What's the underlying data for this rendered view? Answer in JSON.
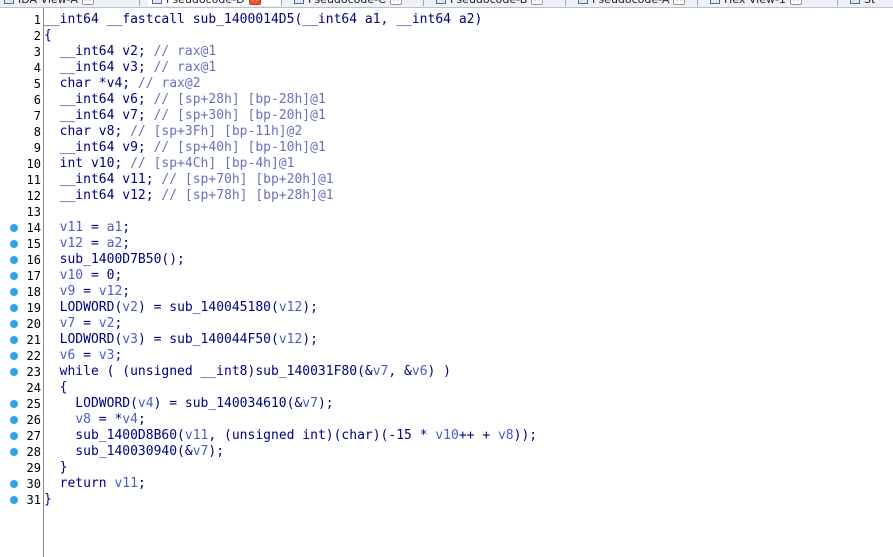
{
  "tabs": [
    {
      "label": "IDA View-A",
      "close": "×",
      "active": false
    },
    {
      "label": "Pseudocode-D",
      "close": "×",
      "active": true
    },
    {
      "label": "Pseudocode-C",
      "close": "×",
      "active": false
    },
    {
      "label": "Pseudocode-B",
      "close": "×",
      "active": false
    },
    {
      "label": "Pseudocode-A",
      "close": "×",
      "active": false
    },
    {
      "label": "Hex View-1",
      "close": "×",
      "active": false
    },
    {
      "label": "St",
      "close": "",
      "active": false
    }
  ],
  "colors": {
    "code_text": "#000080",
    "comment": "#6a70c0",
    "variable": "#4c5cc8",
    "breakpoint_dot": "#2fa3e6"
  },
  "lines": [
    {
      "n": "1",
      "dot": false,
      "segs": [
        {
          "t": "__int64 __fastcall sub_1400014D5(__int64 a1, __int64 a2)",
          "c": ""
        }
      ]
    },
    {
      "n": "2",
      "dot": false,
      "segs": [
        {
          "t": "{",
          "c": ""
        }
      ]
    },
    {
      "n": "3",
      "dot": false,
      "segs": [
        {
          "t": "  __int64 v2; ",
          "c": ""
        },
        {
          "t": "// rax@1",
          "c": "comment"
        }
      ]
    },
    {
      "n": "4",
      "dot": false,
      "segs": [
        {
          "t": "  __int64 v3; ",
          "c": ""
        },
        {
          "t": "// rax@1",
          "c": "comment"
        }
      ]
    },
    {
      "n": "5",
      "dot": false,
      "segs": [
        {
          "t": "  char *v4; ",
          "c": ""
        },
        {
          "t": "// rax@2",
          "c": "comment"
        }
      ]
    },
    {
      "n": "6",
      "dot": false,
      "segs": [
        {
          "t": "  __int64 v6; ",
          "c": ""
        },
        {
          "t": "// [sp+28h] [bp-28h]@1",
          "c": "comment"
        }
      ]
    },
    {
      "n": "7",
      "dot": false,
      "segs": [
        {
          "t": "  __int64 v7; ",
          "c": ""
        },
        {
          "t": "// [sp+30h] [bp-20h]@1",
          "c": "comment"
        }
      ]
    },
    {
      "n": "8",
      "dot": false,
      "segs": [
        {
          "t": "  char v8; ",
          "c": ""
        },
        {
          "t": "// [sp+3Fh] [bp-11h]@2",
          "c": "comment"
        }
      ]
    },
    {
      "n": "9",
      "dot": false,
      "segs": [
        {
          "t": "  __int64 v9; ",
          "c": ""
        },
        {
          "t": "// [sp+40h] [bp-10h]@1",
          "c": "comment"
        }
      ]
    },
    {
      "n": "10",
      "dot": false,
      "segs": [
        {
          "t": "  int v10; ",
          "c": ""
        },
        {
          "t": "// [sp+4Ch] [bp-4h]@1",
          "c": "comment"
        }
      ]
    },
    {
      "n": "11",
      "dot": false,
      "segs": [
        {
          "t": "  __int64 v11; ",
          "c": ""
        },
        {
          "t": "// [sp+70h] [bp+20h]@1",
          "c": "comment"
        }
      ]
    },
    {
      "n": "12",
      "dot": false,
      "segs": [
        {
          "t": "  __int64 v12; ",
          "c": ""
        },
        {
          "t": "// [sp+78h] [bp+28h]@1",
          "c": "comment"
        }
      ]
    },
    {
      "n": "13",
      "dot": false,
      "segs": []
    },
    {
      "n": "14",
      "dot": true,
      "segs": [
        {
          "t": "  ",
          "c": ""
        },
        {
          "t": "v11",
          "c": "var"
        },
        {
          "t": " = ",
          "c": ""
        },
        {
          "t": "a1",
          "c": "var"
        },
        {
          "t": ";",
          "c": ""
        }
      ]
    },
    {
      "n": "15",
      "dot": true,
      "segs": [
        {
          "t": "  ",
          "c": ""
        },
        {
          "t": "v12",
          "c": "var"
        },
        {
          "t": " = ",
          "c": ""
        },
        {
          "t": "a2",
          "c": "var"
        },
        {
          "t": ";",
          "c": ""
        }
      ]
    },
    {
      "n": "16",
      "dot": true,
      "segs": [
        {
          "t": "  sub_1400D7B50();",
          "c": ""
        }
      ]
    },
    {
      "n": "17",
      "dot": true,
      "segs": [
        {
          "t": "  ",
          "c": ""
        },
        {
          "t": "v10",
          "c": "var"
        },
        {
          "t": " = 0;",
          "c": ""
        }
      ]
    },
    {
      "n": "18",
      "dot": true,
      "segs": [
        {
          "t": "  ",
          "c": ""
        },
        {
          "t": "v9",
          "c": "var"
        },
        {
          "t": " = ",
          "c": ""
        },
        {
          "t": "v12",
          "c": "var"
        },
        {
          "t": ";",
          "c": ""
        }
      ]
    },
    {
      "n": "19",
      "dot": true,
      "segs": [
        {
          "t": "  LODWORD(",
          "c": ""
        },
        {
          "t": "v2",
          "c": "var"
        },
        {
          "t": ") = sub_140045180(",
          "c": ""
        },
        {
          "t": "v12",
          "c": "var"
        },
        {
          "t": ");",
          "c": ""
        }
      ]
    },
    {
      "n": "20",
      "dot": true,
      "segs": [
        {
          "t": "  ",
          "c": ""
        },
        {
          "t": "v7",
          "c": "var"
        },
        {
          "t": " = ",
          "c": ""
        },
        {
          "t": "v2",
          "c": "var"
        },
        {
          "t": ";",
          "c": ""
        }
      ]
    },
    {
      "n": "21",
      "dot": true,
      "segs": [
        {
          "t": "  LODWORD(",
          "c": ""
        },
        {
          "t": "v3",
          "c": "var"
        },
        {
          "t": ") = sub_140044F50(",
          "c": ""
        },
        {
          "t": "v12",
          "c": "var"
        },
        {
          "t": ");",
          "c": ""
        }
      ]
    },
    {
      "n": "22",
      "dot": true,
      "segs": [
        {
          "t": "  ",
          "c": ""
        },
        {
          "t": "v6",
          "c": "var"
        },
        {
          "t": " = ",
          "c": ""
        },
        {
          "t": "v3",
          "c": "var"
        },
        {
          "t": ";",
          "c": ""
        }
      ]
    },
    {
      "n": "23",
      "dot": true,
      "segs": [
        {
          "t": "  while ( (unsigned __int8)sub_140031F80(&",
          "c": ""
        },
        {
          "t": "v7",
          "c": "var"
        },
        {
          "t": ", &",
          "c": ""
        },
        {
          "t": "v6",
          "c": "var"
        },
        {
          "t": ") )",
          "c": ""
        }
      ]
    },
    {
      "n": "24",
      "dot": false,
      "segs": [
        {
          "t": "  {",
          "c": ""
        }
      ]
    },
    {
      "n": "25",
      "dot": true,
      "segs": [
        {
          "t": "    LODWORD(",
          "c": ""
        },
        {
          "t": "v4",
          "c": "var"
        },
        {
          "t": ") = sub_140034610(&",
          "c": ""
        },
        {
          "t": "v7",
          "c": "var"
        },
        {
          "t": ");",
          "c": ""
        }
      ]
    },
    {
      "n": "26",
      "dot": true,
      "segs": [
        {
          "t": "    ",
          "c": ""
        },
        {
          "t": "v8",
          "c": "var"
        },
        {
          "t": " = *",
          "c": ""
        },
        {
          "t": "v4",
          "c": "var"
        },
        {
          "t": ";",
          "c": ""
        }
      ]
    },
    {
      "n": "27",
      "dot": true,
      "segs": [
        {
          "t": "    sub_1400D8B60(",
          "c": ""
        },
        {
          "t": "v11",
          "c": "var"
        },
        {
          "t": ", (unsigned int)(char)(-15 * ",
          "c": ""
        },
        {
          "t": "v10",
          "c": "var"
        },
        {
          "t": "++ + ",
          "c": ""
        },
        {
          "t": "v8",
          "c": "var"
        },
        {
          "t": "));",
          "c": ""
        }
      ]
    },
    {
      "n": "28",
      "dot": true,
      "segs": [
        {
          "t": "    sub_140030940(&",
          "c": ""
        },
        {
          "t": "v7",
          "c": "var"
        },
        {
          "t": ");",
          "c": ""
        }
      ]
    },
    {
      "n": "29",
      "dot": false,
      "segs": [
        {
          "t": "  }",
          "c": ""
        }
      ]
    },
    {
      "n": "30",
      "dot": true,
      "segs": [
        {
          "t": "  return ",
          "c": ""
        },
        {
          "t": "v11",
          "c": "var"
        },
        {
          "t": ";",
          "c": ""
        }
      ]
    },
    {
      "n": "31",
      "dot": true,
      "segs": [
        {
          "t": "}",
          "c": ""
        }
      ]
    }
  ]
}
